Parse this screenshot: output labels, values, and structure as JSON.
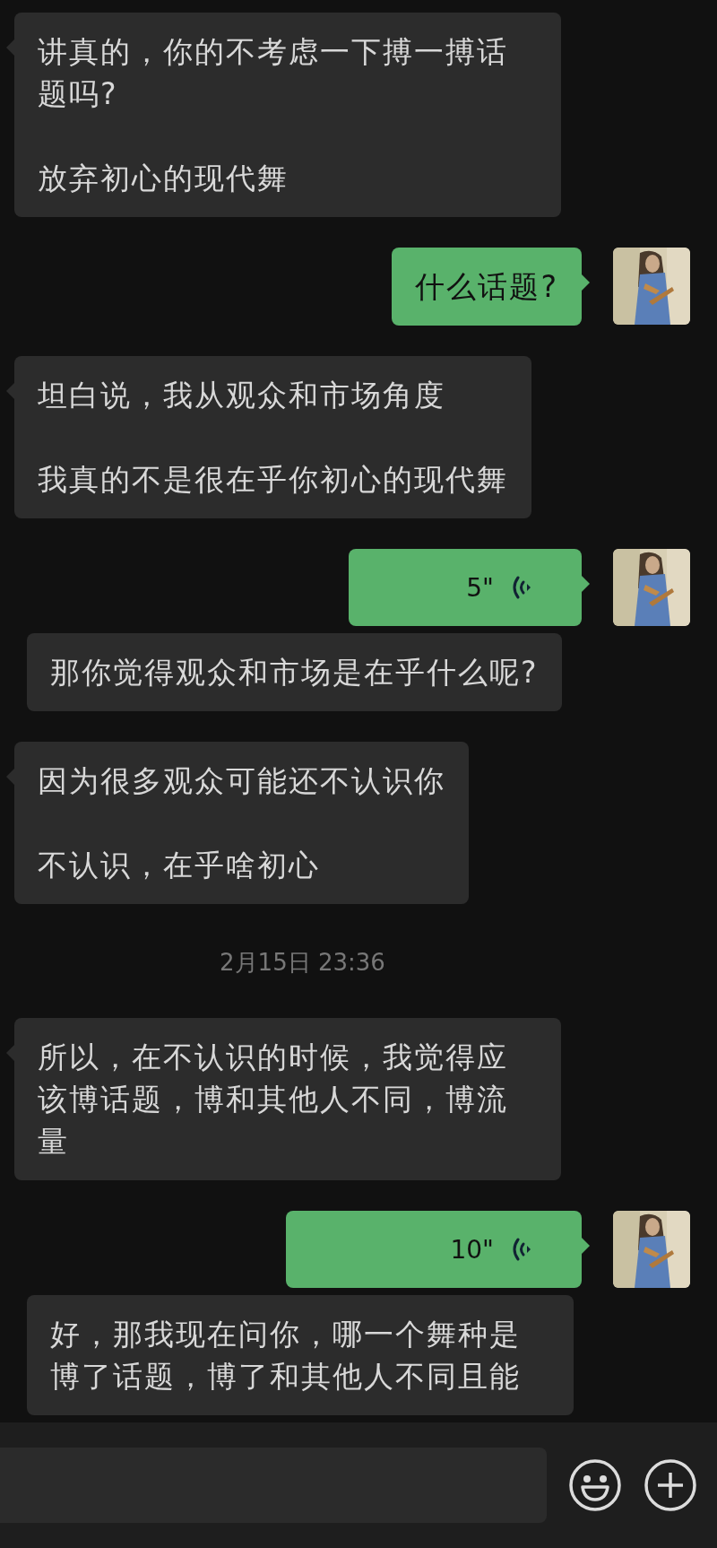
{
  "messages": [
    {
      "kind": "received",
      "tail": true,
      "paragraphs": [
        "讲真的，你的不考虑一下搏一搏话题吗?",
        "放弃初心的现代舞"
      ]
    },
    {
      "kind": "sent",
      "tail": true,
      "paragraphs": [
        "什么话题?"
      ]
    },
    {
      "kind": "received",
      "tail": true,
      "paragraphs": [
        "坦白说，我从观众和市场角度",
        "我真的不是很在乎你初心的现代舞"
      ]
    },
    {
      "kind": "sent_voice",
      "tail": true,
      "duration": "5\""
    },
    {
      "kind": "received",
      "tail": false,
      "paragraphs": [
        "那你觉得观众和市场是在乎什么呢?"
      ]
    },
    {
      "kind": "received",
      "tail": true,
      "paragraphs": [
        "因为很多观众可能还不认识你",
        "不认识，在乎啥初心"
      ]
    },
    {
      "kind": "time",
      "text": "2月15日 23:36"
    },
    {
      "kind": "received",
      "tail": true,
      "paragraphs": [
        "所以，在不认识的时候，我觉得应该博话题，博和其他人不同，博流量"
      ]
    },
    {
      "kind": "sent_voice",
      "tail": true,
      "duration": "10\""
    },
    {
      "kind": "received",
      "tail": false,
      "paragraphs": [
        "好，那我现在问你，哪一个舞种是博了话题，博了和其他人不同且能"
      ]
    }
  ]
}
